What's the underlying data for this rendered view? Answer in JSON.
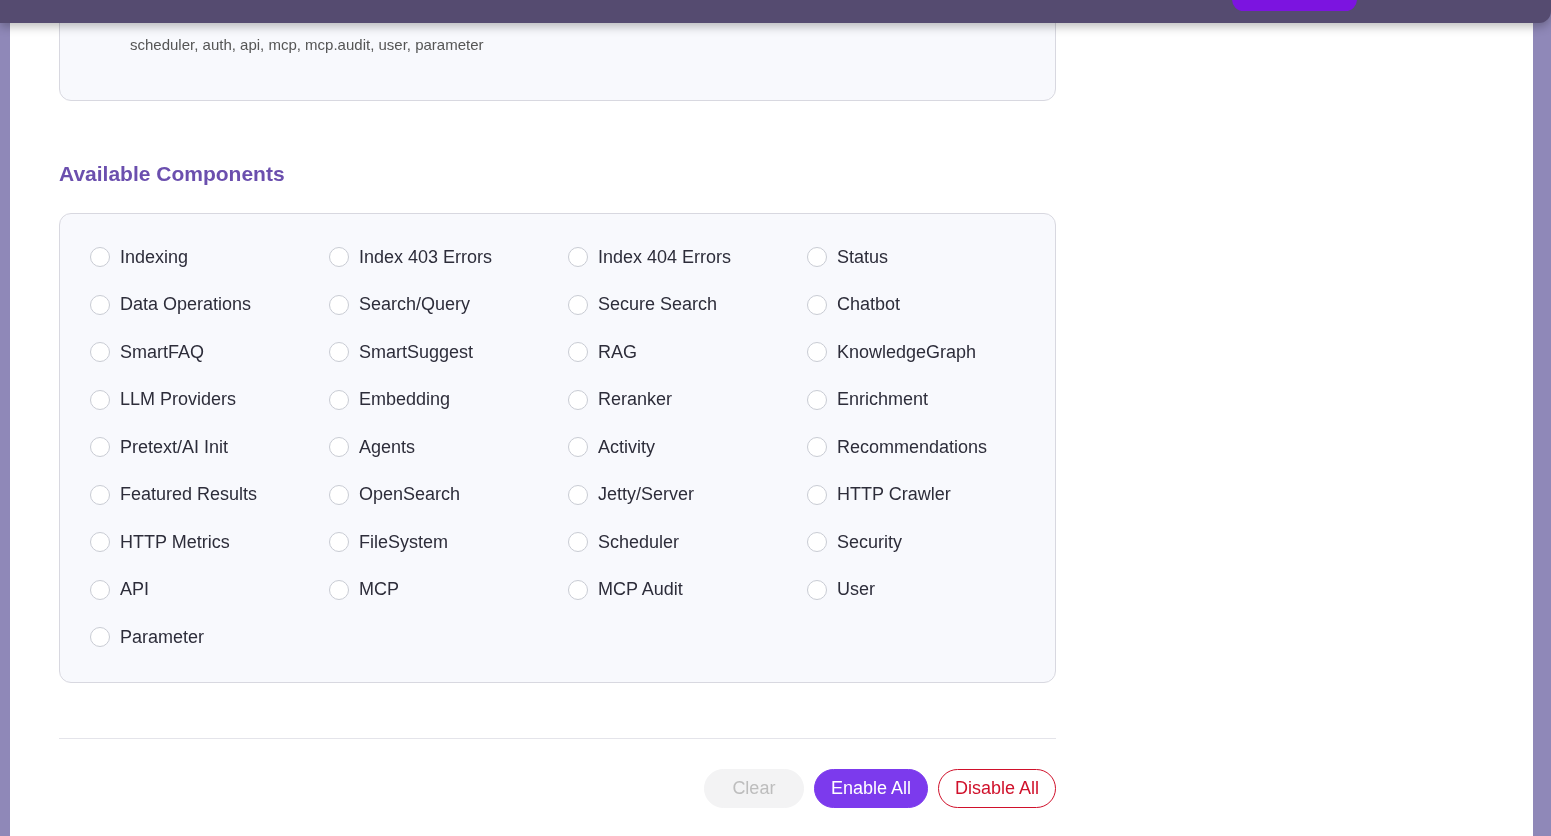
{
  "summary_card": {
    "text": "scheduler, auth, api, mcp, mcp.audit, user, parameter"
  },
  "section_title": "Available Components",
  "components": [
    {
      "label": "Indexing",
      "checked": false
    },
    {
      "label": "Index 403 Errors",
      "checked": false
    },
    {
      "label": "Index 404 Errors",
      "checked": false
    },
    {
      "label": "Status",
      "checked": false
    },
    {
      "label": "Data Operations",
      "checked": false
    },
    {
      "label": "Search/Query",
      "checked": false
    },
    {
      "label": "Secure Search",
      "checked": false
    },
    {
      "label": "Chatbot",
      "checked": false
    },
    {
      "label": "SmartFAQ",
      "checked": false
    },
    {
      "label": "SmartSuggest",
      "checked": false
    },
    {
      "label": "RAG",
      "checked": false
    },
    {
      "label": "KnowledgeGraph",
      "checked": false
    },
    {
      "label": "LLM Providers",
      "checked": false
    },
    {
      "label": "Embedding",
      "checked": false
    },
    {
      "label": "Reranker",
      "checked": false
    },
    {
      "label": "Enrichment",
      "checked": false
    },
    {
      "label": "Pretext/AI Init",
      "checked": false
    },
    {
      "label": "Agents",
      "checked": false
    },
    {
      "label": "Activity",
      "checked": false
    },
    {
      "label": "Recommendations",
      "checked": false
    },
    {
      "label": "Featured Results",
      "checked": false
    },
    {
      "label": "OpenSearch",
      "checked": false
    },
    {
      "label": "Jetty/Server",
      "checked": false
    },
    {
      "label": "HTTP Crawler",
      "checked": false
    },
    {
      "label": "HTTP Metrics",
      "checked": false
    },
    {
      "label": "FileSystem",
      "checked": false
    },
    {
      "label": "Scheduler",
      "checked": false
    },
    {
      "label": "Security",
      "checked": false
    },
    {
      "label": "API",
      "checked": false
    },
    {
      "label": "MCP",
      "checked": false
    },
    {
      "label": "MCP Audit",
      "checked": false
    },
    {
      "label": "User",
      "checked": false
    },
    {
      "label": "Parameter",
      "checked": false
    }
  ],
  "actions": [
    {
      "label": "Clear",
      "kind": "neutral",
      "disabled": true
    },
    {
      "label": "Enable All",
      "kind": "primary",
      "disabled": false
    },
    {
      "label": "Disable All",
      "kind": "danger",
      "disabled": false
    }
  ]
}
